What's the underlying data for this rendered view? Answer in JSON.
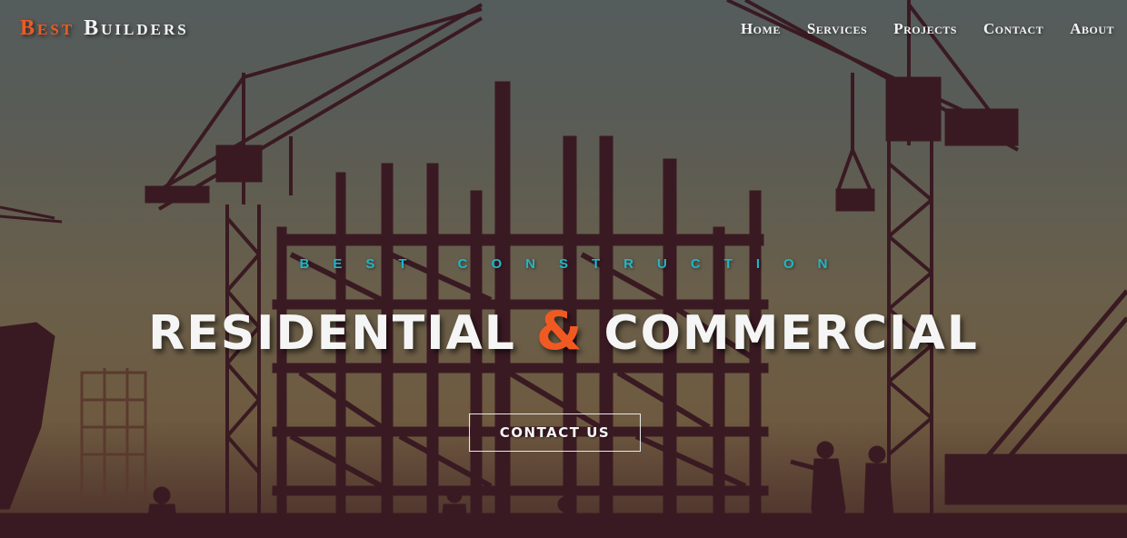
{
  "brand": {
    "word1": "Best",
    "word2": "Builders"
  },
  "nav": {
    "items": [
      "Home",
      "Services",
      "Projects",
      "Contact",
      "About"
    ]
  },
  "hero": {
    "kicker": "BEST CONSTRUCTION",
    "headline_left": "RESIDENTIAL",
    "headline_amp": "&",
    "headline_right": "COMMERCIAL",
    "cta_label": "CONTACT US"
  },
  "colors": {
    "accent": "#f05a22",
    "kicker": "#1fb6c9",
    "silhouette": "#3a1a22",
    "text": "#f5f5f5"
  }
}
